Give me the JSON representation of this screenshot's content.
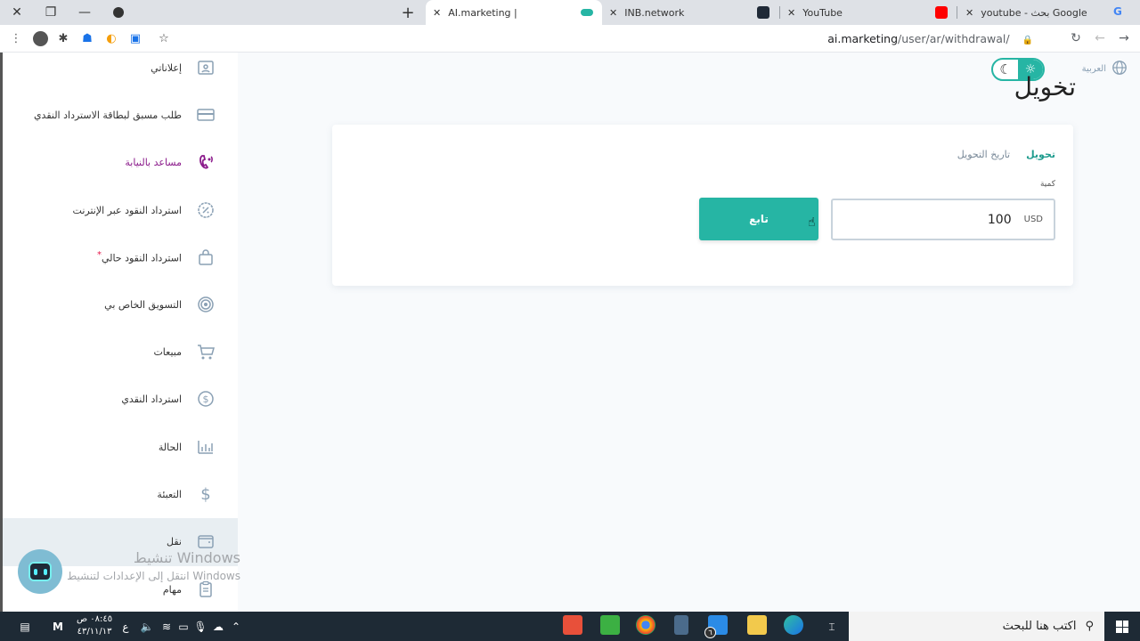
{
  "browser": {
    "tabs": [
      {
        "title": "AI.marketing |",
        "active": true,
        "favicon_color": "#26b5a4"
      },
      {
        "title": "INB.network",
        "active": false,
        "favicon_color": "#1f2937"
      },
      {
        "title": "YouTube",
        "active": false,
        "favicon_color": "#ff0000"
      },
      {
        "title": "youtube - بحث Google",
        "active": false,
        "favicon_color": "#4285f4"
      }
    ],
    "url_host": "ai.marketing",
    "url_path": "/user/ar/withdrawal/",
    "window_controls": [
      "close-icon",
      "restore-icon",
      "minimize-icon",
      "tab-search-icon"
    ],
    "new_tab_label": "+"
  },
  "sidebar": {
    "items": [
      {
        "label": "إعلاناتي",
        "icon": "id-badge-icon"
      },
      {
        "label": "طلب مسبق لبطاقة الاسترداد النقدي",
        "icon": "credit-card-icon"
      },
      {
        "label": "مساعد بالنيابة",
        "icon": "phone-icon",
        "highlight": true
      },
      {
        "label": "استرداد النقود عبر الإنترنت",
        "icon": "percent-badge-icon"
      },
      {
        "label": "استرداد النقود حالي",
        "icon": "shopping-bag-icon",
        "star": "*"
      },
      {
        "label": "التسويق الخاص بي",
        "icon": "target-icon"
      },
      {
        "label": "مبيعات",
        "icon": "cart-icon"
      },
      {
        "label": "استرداد النقدي",
        "icon": "dollar-circle-icon"
      },
      {
        "label": "الحالة",
        "icon": "bar-chart-icon"
      },
      {
        "label": "التعبئة",
        "icon": "dollar-icon"
      },
      {
        "label": "نقل",
        "icon": "wallet-icon",
        "active": true
      },
      {
        "label": "مهام",
        "icon": "clipboard-icon"
      }
    ]
  },
  "header": {
    "language": "العربية",
    "title": "تخويل"
  },
  "card": {
    "tabs": [
      {
        "label": "تحويل",
        "active": true
      },
      {
        "label": "تاريخ التحويل",
        "active": false
      }
    ],
    "amount_label": "كمية",
    "amount_value": "100",
    "currency": "USD",
    "continue_label": "تابع"
  },
  "watermark": {
    "line1": "تنشيط Windows",
    "line2": "انتقل إلى الإعدادات لتنشيط Windows"
  },
  "taskbar": {
    "search_placeholder": "اكتب هنا للبحث",
    "time": "٠٨:٤٥ ص",
    "date": "٤٣/١١/١٣",
    "lang": "ع",
    "mail_badge": "٦"
  },
  "colors": {
    "accent": "#26b5a4",
    "highlight": "#8b1a8b"
  }
}
